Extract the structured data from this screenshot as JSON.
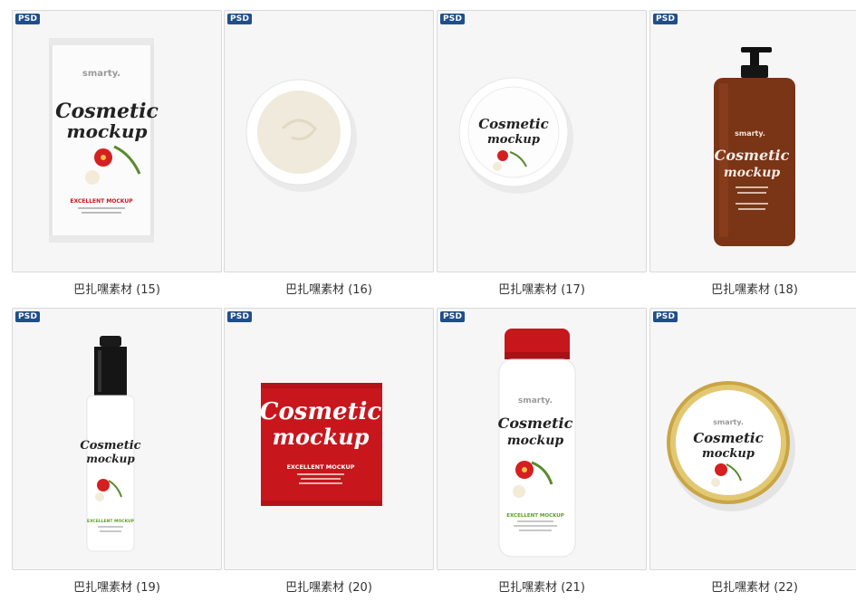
{
  "items": [
    {
      "badge": "PSD",
      "name": "巴扎嘿素材 (15)",
      "brand": "smarty.",
      "title1": "Cosmetic",
      "title2": "mockup",
      "tag": "EXCELLENT MOCKUP",
      "icon": "sachet-white-mockup"
    },
    {
      "badge": "PSD",
      "name": "巴扎嘿素材 (16)",
      "icon": "cream-jar-open-mockup"
    },
    {
      "badge": "PSD",
      "name": "巴扎嘿素材 (17)",
      "title1": "Cosmetic",
      "title2": "mockup",
      "icon": "cream-jar-lid-mockup"
    },
    {
      "badge": "PSD",
      "name": "巴扎嘿素材 (18)",
      "brand": "smarty.",
      "title1": "Cosmetic",
      "title2": "mockup",
      "icon": "pump-bottle-amber-mockup"
    },
    {
      "badge": "PSD",
      "name": "巴扎嘿素材 (19)",
      "title1": "Cosmetic",
      "title2": "mockup",
      "tag": "EXCELLENT MOCKUP",
      "icon": "spray-bottle-mockup"
    },
    {
      "badge": "PSD",
      "name": "巴扎嘿素材 (20)",
      "title1": "Cosmetic",
      "title2": "mockup",
      "tag": "EXCELLENT MOCKUP",
      "icon": "sachet-red-mockup"
    },
    {
      "badge": "PSD",
      "name": "巴扎嘿素材 (21)",
      "brand": "smarty.",
      "title1": "Cosmetic",
      "title2": "mockup",
      "tag": "EXCELLENT MOCKUP",
      "icon": "shampoo-bottle-mockup"
    },
    {
      "badge": "PSD",
      "name": "巴扎嘿素材 (22)",
      "brand": "smarty.",
      "title1": "Cosmetic",
      "title2": "mockup",
      "icon": "gold-tin-mockup"
    }
  ],
  "colors": {
    "badge": "#1f4e8c",
    "accent_red": "#c8161d",
    "amber": "#7a3416",
    "gold": "#c9a545"
  }
}
